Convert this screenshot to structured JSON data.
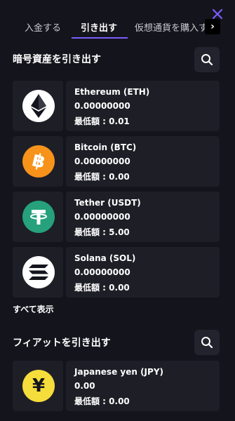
{
  "tabs": [
    "入金する",
    "引き出す",
    "仮想通貨を購入す"
  ],
  "tab_scroll_glyph": "›",
  "crypto_section": {
    "title": "暗号資産を引き出す",
    "assets": [
      {
        "name": "Ethereum (ETH)",
        "balance": "0.00000000",
        "min": "最低額 : 0.01",
        "icon": "ethereum-icon"
      },
      {
        "name": "Bitcoin (BTC)",
        "balance": "0.00000000",
        "min": "最低額 : 0.00",
        "icon": "bitcoin-icon"
      },
      {
        "name": "Tether (USDT)",
        "balance": "0.00000000",
        "min": "最低額 : 5.00",
        "icon": "tether-icon"
      },
      {
        "name": "Solana (SOL)",
        "balance": "0.00000000",
        "min": "最低額 : 0.00",
        "icon": "solana-icon"
      }
    ],
    "show_all": "すべて表示"
  },
  "fiat_section": {
    "title": "フィアットを引き出す",
    "assets": [
      {
        "name": "Japanese yen (JPY)",
        "balance": "0.00",
        "min": "最低額 : 0.00",
        "icon": "yen-icon"
      }
    ]
  },
  "colors": {
    "background": "#14141c",
    "card": "#1e1e27",
    "accent": "#7b5cff",
    "bitcoin": "#f7931a",
    "tether": "#26a17b",
    "yen": "#f5dd3b"
  }
}
